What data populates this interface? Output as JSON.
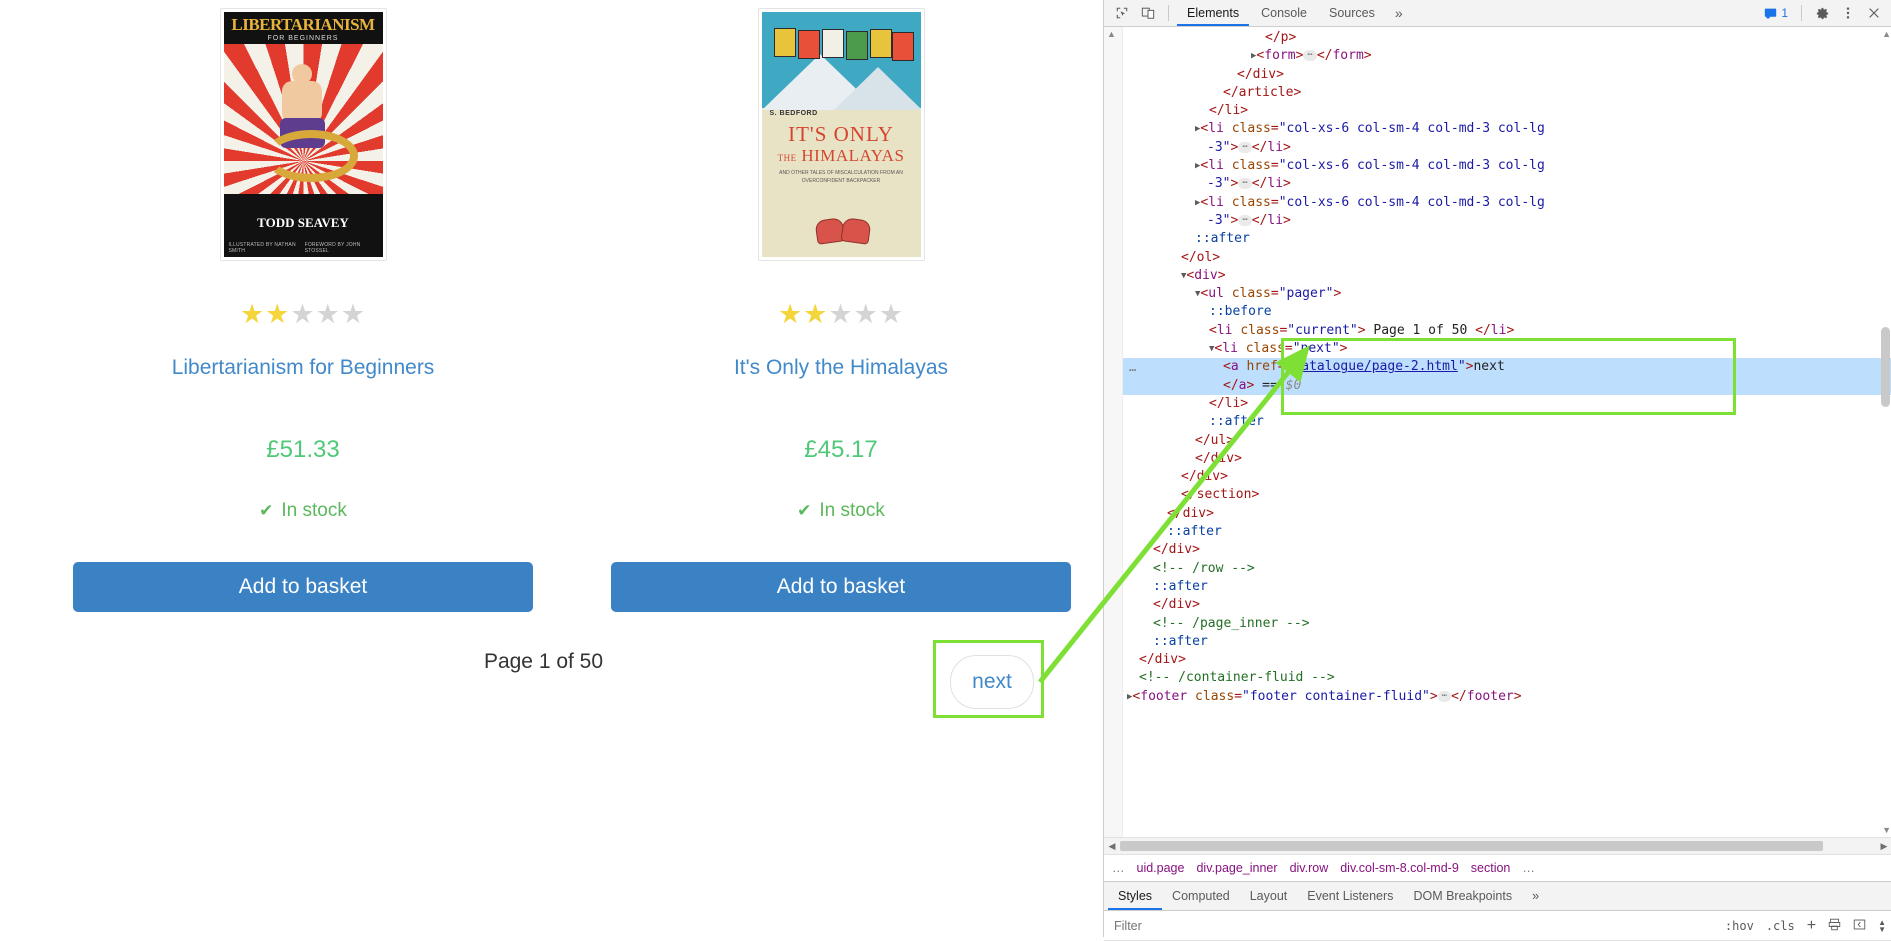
{
  "page": {
    "products": [
      {
        "title": "Libertarianism for Beginners",
        "price": "£51.33",
        "stock": "In stock",
        "rating": 2,
        "button": "Add to basket",
        "cover": {
          "title": "LIBERTARIANISM",
          "subtitle": "FOR BEGINNERS",
          "author": "TODD SEAVEY",
          "credit_left": "ILLUSTRATED BY NATHAN SMITH",
          "credit_right": "FOREWORD BY JOHN STOSSEL"
        }
      },
      {
        "title": "It's Only the Himalayas",
        "price": "£45.17",
        "stock": "In stock",
        "rating": 2,
        "button": "Add to basket",
        "cover": {
          "author": "S. BEDFORD",
          "title_line1": "IT'S ONLY",
          "title_line2_small": "THE",
          "title_line2": "HIMALAYAS",
          "tagline": "AND OTHER TALES OF MISCALCULATION FROM AN OVERCONFIDENT BACKPACKER"
        }
      }
    ],
    "pager": {
      "current": "Page 1 of 50",
      "next_label": "next"
    }
  },
  "devtools": {
    "toolbar": {
      "inspect_icon": "inspect-element-icon",
      "device_icon": "device-toolbar-icon",
      "tabs": [
        {
          "label": "Elements",
          "active": true
        },
        {
          "label": "Console",
          "active": false
        },
        {
          "label": "Sources",
          "active": false
        }
      ],
      "more_tabs": "»",
      "message_count": "1",
      "settings_icon": "gear-icon",
      "kebab_icon": "more-options-icon",
      "close_icon": "close-icon"
    },
    "dom_lines": [
      {
        "indent": 8,
        "parts": [
          {
            "t": "tag",
            "v": "</p>"
          }
        ]
      },
      {
        "indent": 7,
        "twisty": "closed",
        "parts": [
          {
            "t": "tag",
            "v": "<"
          },
          {
            "t": "tagname",
            "v": "form"
          },
          {
            "t": "tag",
            "v": ">"
          },
          {
            "t": "ellipsis",
            "v": "…"
          },
          {
            "t": "tag",
            "v": "</"
          },
          {
            "t": "tagname",
            "v": "form"
          },
          {
            "t": "tag",
            "v": ">"
          }
        ]
      },
      {
        "indent": 6,
        "parts": [
          {
            "t": "tag",
            "v": "</div>"
          }
        ]
      },
      {
        "indent": 5,
        "parts": [
          {
            "t": "tag",
            "v": "</article>"
          }
        ]
      },
      {
        "indent": 4,
        "parts": [
          {
            "t": "tag",
            "v": "</li>"
          }
        ]
      },
      {
        "indent": 3,
        "twisty": "closed",
        "parts": [
          {
            "t": "tag",
            "v": "<"
          },
          {
            "t": "tagname",
            "v": "li"
          },
          {
            "t": "txt",
            "v": " "
          },
          {
            "t": "attr",
            "v": "class"
          },
          {
            "t": "tag",
            "v": "="
          },
          {
            "t": "val",
            "v": "\"col-xs-6 col-sm-4 col-md-3 col-lg"
          }
        ]
      },
      {
        "indent": 3,
        "cont": true,
        "parts": [
          {
            "t": "val",
            "v": "-3\""
          },
          {
            "t": "tag",
            "v": ">"
          },
          {
            "t": "ellipsis",
            "v": "…"
          },
          {
            "t": "tag",
            "v": "</"
          },
          {
            "t": "tagname",
            "v": "li"
          },
          {
            "t": "tag",
            "v": ">"
          }
        ]
      },
      {
        "indent": 3,
        "twisty": "closed",
        "parts": [
          {
            "t": "tag",
            "v": "<"
          },
          {
            "t": "tagname",
            "v": "li"
          },
          {
            "t": "txt",
            "v": " "
          },
          {
            "t": "attr",
            "v": "class"
          },
          {
            "t": "tag",
            "v": "="
          },
          {
            "t": "val",
            "v": "\"col-xs-6 col-sm-4 col-md-3 col-lg"
          }
        ]
      },
      {
        "indent": 3,
        "cont": true,
        "parts": [
          {
            "t": "val",
            "v": "-3\""
          },
          {
            "t": "tag",
            "v": ">"
          },
          {
            "t": "ellipsis",
            "v": "…"
          },
          {
            "t": "tag",
            "v": "</"
          },
          {
            "t": "tagname",
            "v": "li"
          },
          {
            "t": "tag",
            "v": ">"
          }
        ]
      },
      {
        "indent": 3,
        "twisty": "closed",
        "parts": [
          {
            "t": "tag",
            "v": "<"
          },
          {
            "t": "tagname",
            "v": "li"
          },
          {
            "t": "txt",
            "v": " "
          },
          {
            "t": "attr",
            "v": "class"
          },
          {
            "t": "tag",
            "v": "="
          },
          {
            "t": "val",
            "v": "\"col-xs-6 col-sm-4 col-md-3 col-lg"
          }
        ]
      },
      {
        "indent": 3,
        "cont": true,
        "parts": [
          {
            "t": "val",
            "v": "-3\""
          },
          {
            "t": "tag",
            "v": ">"
          },
          {
            "t": "ellipsis",
            "v": "…"
          },
          {
            "t": "tag",
            "v": "</"
          },
          {
            "t": "tagname",
            "v": "li"
          },
          {
            "t": "tag",
            "v": ">"
          }
        ]
      },
      {
        "indent": 3,
        "parts": [
          {
            "t": "pseudo",
            "v": "::after"
          }
        ]
      },
      {
        "indent": 2,
        "parts": [
          {
            "t": "tag",
            "v": "</ol>"
          }
        ]
      },
      {
        "indent": 2,
        "twisty": "open",
        "parts": [
          {
            "t": "tag",
            "v": "<"
          },
          {
            "t": "tagname",
            "v": "div"
          },
          {
            "t": "tag",
            "v": ">"
          }
        ]
      },
      {
        "indent": 3,
        "twisty": "open",
        "parts": [
          {
            "t": "tag",
            "v": "<"
          },
          {
            "t": "tagname",
            "v": "ul"
          },
          {
            "t": "txt",
            "v": " "
          },
          {
            "t": "attr",
            "v": "class"
          },
          {
            "t": "tag",
            "v": "="
          },
          {
            "t": "val",
            "v": "\"pager\""
          },
          {
            "t": "tag",
            "v": ">"
          }
        ]
      },
      {
        "indent": 4,
        "parts": [
          {
            "t": "pseudo",
            "v": "::before"
          }
        ]
      },
      {
        "indent": 4,
        "parts": [
          {
            "t": "tag",
            "v": "<"
          },
          {
            "t": "tagname",
            "v": "li"
          },
          {
            "t": "txt",
            "v": " "
          },
          {
            "t": "attr",
            "v": "class"
          },
          {
            "t": "tag",
            "v": "="
          },
          {
            "t": "val",
            "v": "\"current\""
          },
          {
            "t": "tag",
            "v": ">"
          },
          {
            "t": "txt",
            "v": " Page 1 of 50 "
          },
          {
            "t": "tag",
            "v": "</"
          },
          {
            "t": "tagname",
            "v": "li"
          },
          {
            "t": "tag",
            "v": ">"
          }
        ]
      },
      {
        "indent": 4,
        "twisty": "open",
        "parts": [
          {
            "t": "tag",
            "v": "<"
          },
          {
            "t": "tagname",
            "v": "li"
          },
          {
            "t": "txt",
            "v": " "
          },
          {
            "t": "attr",
            "v": "class"
          },
          {
            "t": "tag",
            "v": "="
          },
          {
            "t": "val",
            "v": "\"next\""
          },
          {
            "t": "tag",
            "v": ">"
          }
        ]
      },
      {
        "indent": 5,
        "selected": true,
        "dots": true,
        "parts": [
          {
            "t": "tag",
            "v": "<"
          },
          {
            "t": "tagname",
            "v": "a"
          },
          {
            "t": "txt",
            "v": " "
          },
          {
            "t": "attr",
            "v": "href"
          },
          {
            "t": "tag",
            "v": "="
          },
          {
            "t": "val",
            "v": "\""
          },
          {
            "t": "link",
            "v": "catalogue/page-2.html"
          },
          {
            "t": "val",
            "v": "\""
          },
          {
            "t": "tag",
            "v": ">"
          },
          {
            "t": "txt",
            "v": "next"
          }
        ]
      },
      {
        "indent": 5,
        "selected": true,
        "parts": [
          {
            "t": "tag",
            "v": "</"
          },
          {
            "t": "tagname",
            "v": "a"
          },
          {
            "t": "tag",
            "v": ">"
          },
          {
            "t": "txt",
            "v": " == "
          },
          {
            "t": "dollar",
            "v": "$0"
          }
        ]
      },
      {
        "indent": 4,
        "parts": [
          {
            "t": "tag",
            "v": "</li>"
          }
        ]
      },
      {
        "indent": 4,
        "parts": [
          {
            "t": "pseudo",
            "v": "::after"
          }
        ]
      },
      {
        "indent": 3,
        "parts": [
          {
            "t": "tag",
            "v": "</ul>"
          }
        ]
      },
      {
        "indent": 3,
        "parts": [
          {
            "t": "tag",
            "v": "</div>"
          }
        ]
      },
      {
        "indent": 2,
        "parts": [
          {
            "t": "tag",
            "v": "</div>"
          }
        ]
      },
      {
        "indent": 2,
        "parts": [
          {
            "t": "tag",
            "v": "</section>"
          }
        ]
      },
      {
        "indent": 1,
        "parts": [
          {
            "t": "tag",
            "v": "</div>"
          }
        ]
      },
      {
        "indent": 1,
        "parts": [
          {
            "t": "pseudo",
            "v": "::after"
          }
        ]
      },
      {
        "indent": 0,
        "parts": [
          {
            "t": "tag",
            "v": "</div>"
          }
        ]
      },
      {
        "indent": 0,
        "parts": [
          {
            "t": "comment",
            "v": "<!-- /row -->"
          }
        ]
      },
      {
        "indent": 0,
        "parts": [
          {
            "t": "pseudo",
            "v": "::after"
          }
        ]
      },
      {
        "indent": 0,
        "parts": [
          {
            "t": "tag",
            "v": "</div>"
          }
        ]
      },
      {
        "indent": 0,
        "parts": [
          {
            "t": "comment",
            "v": "<!-- /page_inner -->"
          }
        ]
      },
      {
        "indent": 0,
        "parts": [
          {
            "t": "pseudo",
            "v": "::after"
          }
        ]
      },
      {
        "indent": -1,
        "parts": [
          {
            "t": "tag",
            "v": "</div>"
          }
        ]
      },
      {
        "indent": -1,
        "parts": [
          {
            "t": "comment",
            "v": "<!-- /container-fluid -->"
          }
        ]
      },
      {
        "indent": -2,
        "twisty": "closed",
        "parts": [
          {
            "t": "tag",
            "v": "<"
          },
          {
            "t": "tagname",
            "v": "footer"
          },
          {
            "t": "txt",
            "v": " "
          },
          {
            "t": "attr",
            "v": "class"
          },
          {
            "t": "tag",
            "v": "="
          },
          {
            "t": "val",
            "v": "\"footer container-fluid\""
          },
          {
            "t": "tag",
            "v": ">"
          },
          {
            "t": "ellipsis",
            "v": "…"
          },
          {
            "t": "tag",
            "v": "</"
          },
          {
            "t": "tagname",
            "v": "footer"
          },
          {
            "t": "tag",
            "v": ">"
          }
        ]
      }
    ],
    "breadcrumbs": [
      {
        "label": "…",
        "dim": true
      },
      {
        "label": "uid.page",
        "dim": false
      },
      {
        "label": "div.page_inner",
        "dim": false
      },
      {
        "label": "div.row",
        "dim": false
      },
      {
        "label": "div.col-sm-8.col-md-9",
        "dim": false
      },
      {
        "label": "section",
        "dim": false
      },
      {
        "label": "…",
        "dim": true
      }
    ],
    "pane_tabs": [
      {
        "label": "Styles",
        "active": true
      },
      {
        "label": "Computed",
        "active": false
      },
      {
        "label": "Layout",
        "active": false
      },
      {
        "label": "Event Listeners",
        "active": false
      },
      {
        "label": "DOM Breakpoints",
        "active": false
      }
    ],
    "pane_more": "»",
    "filter": {
      "placeholder": "Filter",
      "value": ""
    },
    "filter_tools": {
      "hov": ":hov",
      "cls": ".cls",
      "new_rule": "+",
      "print_icon": "print-styles-icon",
      "sidebar_icon": "toggle-sidebar-icon"
    }
  },
  "colors": {
    "accent_blue": "#4189c9",
    "button_blue": "#3b82c4",
    "price_green": "#50c878",
    "stock_green": "#5cb85c",
    "highlight_green": "#7ee035",
    "star_gold": "#f4d53b",
    "devtools_tab_blue": "#1a73e8",
    "selection_blue": "#bddffd"
  }
}
